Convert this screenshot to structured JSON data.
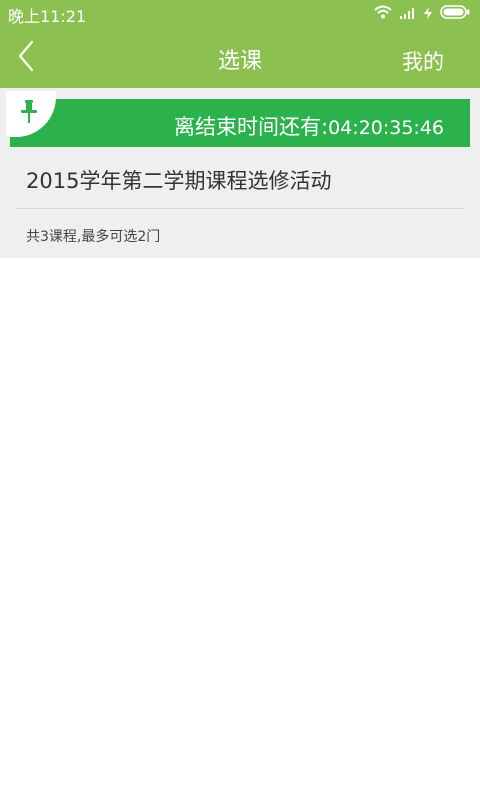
{
  "status_bar": {
    "time": "晚上11:21",
    "icons": [
      "wifi-icon",
      "signal-icon",
      "charging-icon",
      "battery-icon"
    ]
  },
  "header": {
    "back_icon": "chevron-left-icon",
    "title": "选课",
    "mine_label": "我的",
    "background_color": "#8cc152"
  },
  "activity": {
    "countdown_label": "离结束时间还有:",
    "countdown_value": "04:20:35:46",
    "countdown_color": "#2bb24c",
    "pin_icon": "pin-icon",
    "title": "2015学年第二学期课程选修活动",
    "info": "共3课程,最多可选2门"
  }
}
